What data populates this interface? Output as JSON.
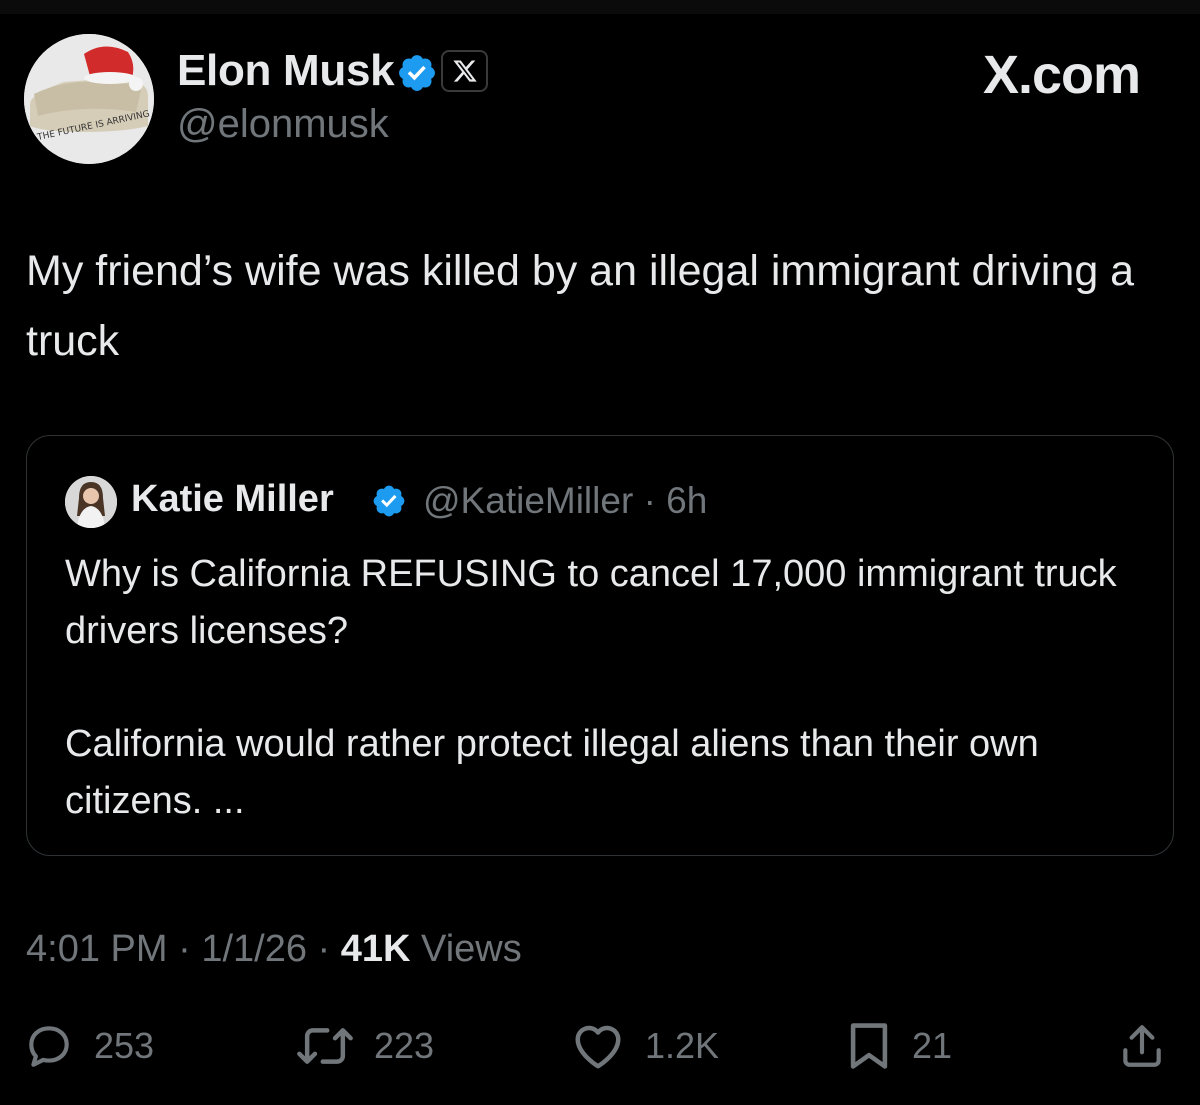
{
  "brand": {
    "watermark": "X.com"
  },
  "author": {
    "display_name": "Elon Musk",
    "handle": "@elonmusk",
    "verified": true,
    "affiliate_badge": "X",
    "avatar_caption": "THE FUTURE IS ARRIVING"
  },
  "post": {
    "text": "My friend’s wife was killed by an illegal immigrant driving a truck"
  },
  "quoted_post": {
    "display_name": "Katie Miller",
    "handle": "@KatieMiller",
    "separator": "·",
    "age": "6h",
    "paragraphs": [
      "Why is California REFUSING to cancel 17,000 immigrant truck drivers licenses?",
      "California would rather protect illegal aliens than their own citizens. ..."
    ]
  },
  "meta": {
    "time": "4:01 PM",
    "sep1": "·",
    "date": "1/1/26",
    "sep2": "·",
    "views_count": "41K",
    "views_label": "Views"
  },
  "actions": {
    "replies": "253",
    "reposts": "223",
    "likes": "1.2K",
    "bookmarks": "21"
  },
  "colors": {
    "background": "#000000",
    "text_primary": "#e7e9ea",
    "text_secondary": "#71767b",
    "verified_blue": "#1d9bf0",
    "card_border": "#2f3336"
  }
}
